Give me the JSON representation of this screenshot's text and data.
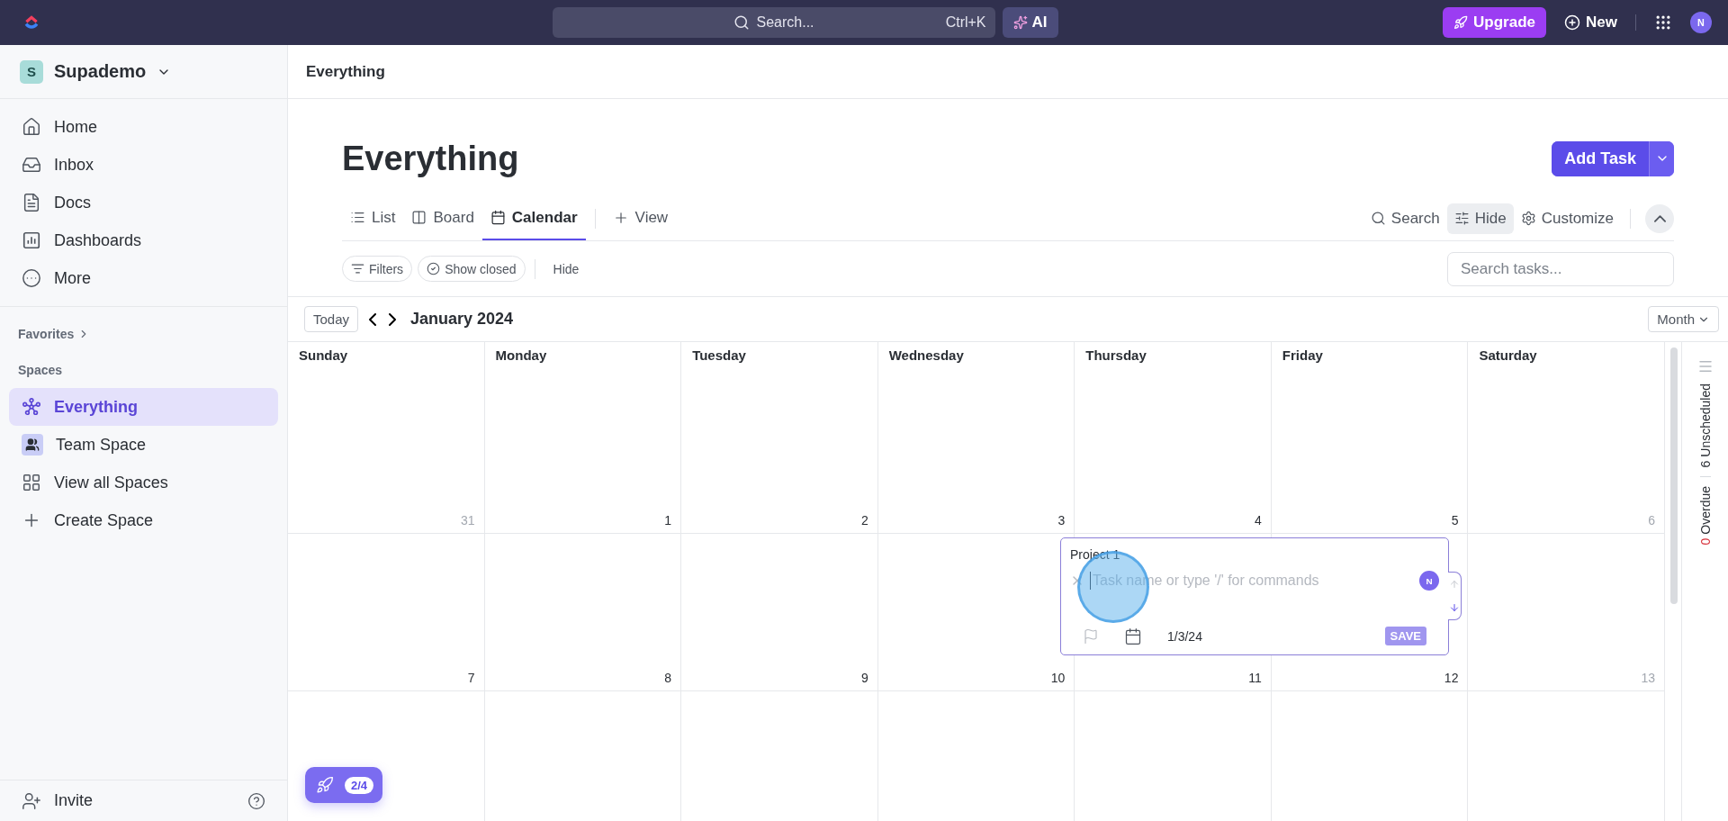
{
  "topbar": {
    "search_placeholder": "Search...",
    "shortcut": "Ctrl+K",
    "ai": "AI",
    "upgrade": "Upgrade",
    "new": "New",
    "avatar": "N"
  },
  "sidebar": {
    "workspace": {
      "initial": "S",
      "name": "Supademo"
    },
    "nav": [
      {
        "label": "Home"
      },
      {
        "label": "Inbox"
      },
      {
        "label": "Docs"
      },
      {
        "label": "Dashboards"
      },
      {
        "label": "More"
      }
    ],
    "favorites": "Favorites",
    "spaces_label": "Spaces",
    "spaces": [
      {
        "label": "Everything",
        "selected": true
      },
      {
        "label": "Team Space",
        "selected": false
      },
      {
        "label": "View all Spaces",
        "selected": false
      },
      {
        "label": "Create Space",
        "selected": false
      }
    ],
    "invite": "Invite"
  },
  "breadcrumb": "Everything",
  "title": "Everything",
  "add_task": "Add Task",
  "views": [
    {
      "label": "List",
      "selected": false
    },
    {
      "label": "Board",
      "selected": false
    },
    {
      "label": "Calendar",
      "selected": true
    }
  ],
  "add_view": "View",
  "tools": [
    {
      "label": "Search",
      "active": false
    },
    {
      "label": "Hide",
      "active": true
    },
    {
      "label": "Customize",
      "active": false
    }
  ],
  "filters": [
    {
      "label": "Filters"
    },
    {
      "label": "Show closed"
    }
  ],
  "filter_hide": "Hide",
  "search_tasks_placeholder": "Search tasks...",
  "calendar": {
    "today": "Today",
    "month": "January 2024",
    "view": "Month",
    "days": [
      "Sunday",
      "Monday",
      "Tuesday",
      "Wednesday",
      "Thursday",
      "Friday",
      "Saturday"
    ],
    "weeks": [
      [
        {
          "day": "31",
          "muted": true
        },
        {
          "day": "1",
          "muted": false
        },
        {
          "day": "2",
          "muted": false
        },
        {
          "day": "3",
          "muted": false
        },
        {
          "day": "4",
          "muted": false
        },
        {
          "day": "5",
          "muted": false
        },
        {
          "day": "6",
          "muted": true
        }
      ],
      [
        {
          "day": "7",
          "muted": false
        },
        {
          "day": "8",
          "muted": false
        },
        {
          "day": "9",
          "muted": false
        },
        {
          "day": "10",
          "muted": false
        },
        {
          "day": "11",
          "muted": false
        },
        {
          "day": "12",
          "muted": false
        },
        {
          "day": "13",
          "muted": true
        }
      ]
    ]
  },
  "task_popup": {
    "list": "Project 1",
    "placeholder": "Task name or type '/' for commands",
    "avatar": "N",
    "date": "1/3/24",
    "save": "SAVE"
  },
  "side_panel": {
    "unscheduled_count": "6",
    "unscheduled": "Unscheduled",
    "overdue_count": "0",
    "overdue": "Overdue"
  },
  "progress": "2/4"
}
